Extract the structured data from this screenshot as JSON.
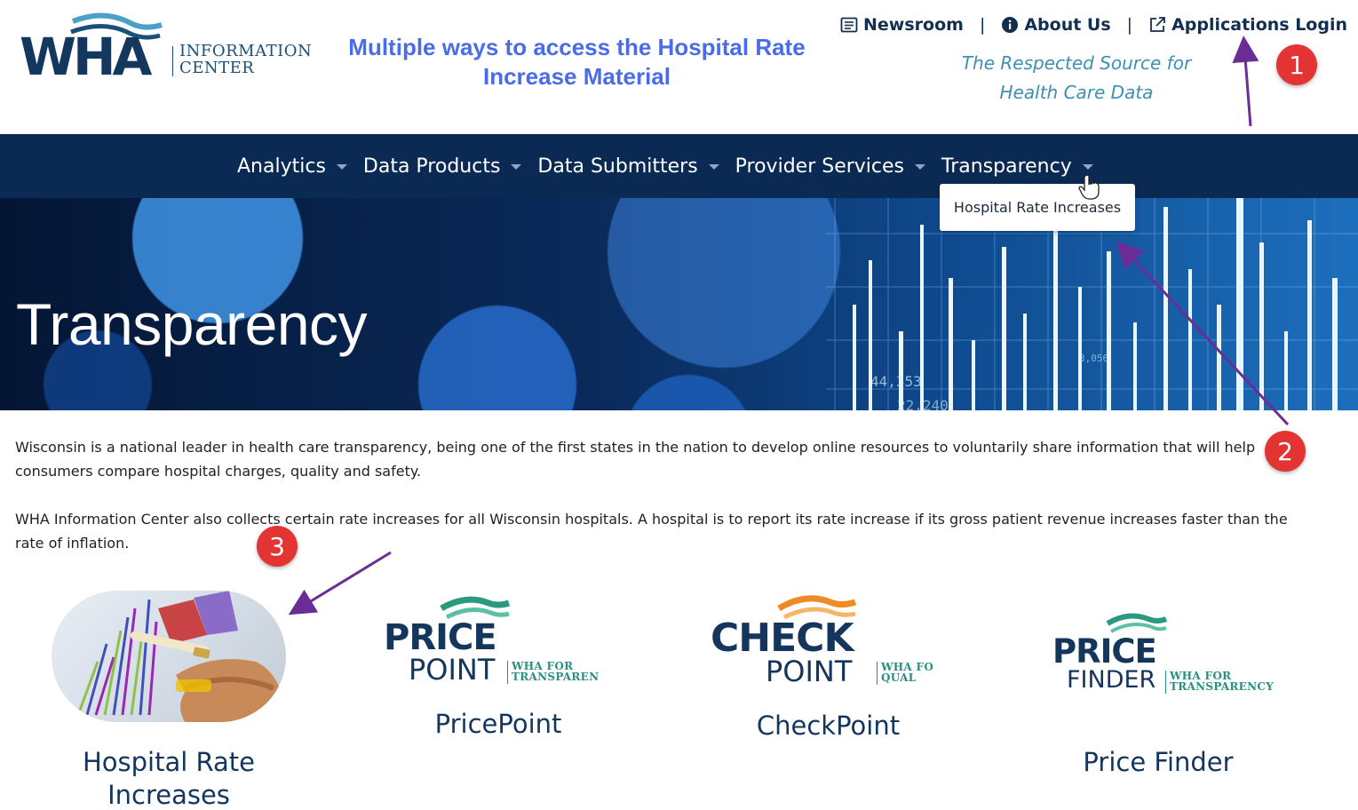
{
  "annotation": {
    "headline": "Multiple ways to access the Hospital Rate Increase Material",
    "badges": [
      "1",
      "2",
      "3"
    ]
  },
  "logo": {
    "mark": "WHA",
    "line1": "INFORMATION",
    "line2": "CENTER"
  },
  "header": {
    "links": [
      {
        "label": "Newsroom",
        "icon": "newspaper-icon"
      },
      {
        "label": "About Us",
        "icon": "info-icon"
      },
      {
        "label": "Applications Login",
        "icon": "external-link-icon"
      }
    ],
    "tagline_line1": "The Respected Source for",
    "tagline_line2": "Health Care Data"
  },
  "nav": {
    "items": [
      "Analytics",
      "Data Products",
      "Data Submitters",
      "Provider Services",
      "Transparency"
    ],
    "dropdown_item": "Hospital Rate Increases"
  },
  "hero": {
    "title": "Transparency",
    "chart_labels": [
      "44,353",
      "22,240",
      "3,056"
    ]
  },
  "body": {
    "paragraph1": "Wisconsin is a national leader in health care transparency, being one of the first states in the nation to develop online resources to voluntarily share information that will help consumers compare hospital charges, quality and safety.",
    "paragraph2": "WHA Information Center also collects certain rate increases for all Wisconsin hospitals.  A hospital is to report its rate increase if its gross patient revenue increases faster than the rate of inflation."
  },
  "tiles": [
    {
      "label_line1": "Hospital Rate",
      "label_line2": "Increases"
    },
    {
      "label": "PricePoint",
      "logo_line1": "PRICE",
      "logo_line2": "POINT",
      "logo_sub1": "WHA FOR",
      "logo_sub2": "TRANSPAREN"
    },
    {
      "label": "CheckPoint",
      "logo_line1": "CHECK",
      "logo_line2": "POINT",
      "logo_sub1": "WHA FO",
      "logo_sub2": "QUAL"
    },
    {
      "label": "Price Finder",
      "logo_line1": "PRICE",
      "logo_line2": "FINDER",
      "logo_sub1": "WHA FOR",
      "logo_sub2": "TRANSPARENCY"
    }
  ],
  "colors": {
    "navy": "#0b2a53",
    "headline_blue": "#4a6ce8",
    "tagline_teal": "#3e8fb0",
    "badge_red": "#e33333",
    "arrow_purple": "#6a2d96",
    "wave_green": "#2a9a7e",
    "wave_orange": "#f08a24"
  }
}
